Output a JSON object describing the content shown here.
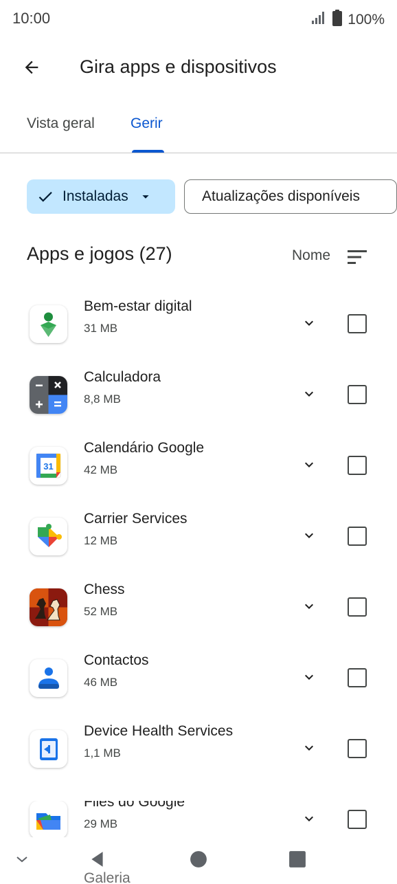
{
  "status": {
    "time": "10:00",
    "battery": "100%"
  },
  "header": {
    "title": "Gira apps e dispositivos"
  },
  "tabs": [
    {
      "label": "Vista geral",
      "active": false
    },
    {
      "label": "Gerir",
      "active": true
    }
  ],
  "filters": {
    "installed": "Instaladas",
    "updates": "Atualizações disponíveis"
  },
  "list": {
    "title": "Apps e jogos (27)",
    "sort_label": "Nome",
    "apps": [
      {
        "name": "Bem-estar digital",
        "size": "31 MB",
        "icon": "digital-wellbeing-icon"
      },
      {
        "name": "Calculadora",
        "size": "8,8 MB",
        "icon": "calculator-icon"
      },
      {
        "name": "Calendário Google",
        "size": "42 MB",
        "icon": "google-calendar-icon"
      },
      {
        "name": "Carrier Services",
        "size": "12 MB",
        "icon": "carrier-services-icon"
      },
      {
        "name": "Chess",
        "size": "52 MB",
        "icon": "chess-icon"
      },
      {
        "name": "Contactos",
        "size": "46 MB",
        "icon": "contacts-icon"
      },
      {
        "name": "Device Health Services",
        "size": "1,1 MB",
        "icon": "device-health-icon"
      },
      {
        "name": "Files do Google",
        "size": "29 MB",
        "icon": "files-icon"
      },
      {
        "name": "Galeria",
        "size": "",
        "icon": "gallery-icon"
      }
    ]
  },
  "colors": {
    "accent": "#0b57d0",
    "chip_selected_bg": "#c2e7ff",
    "text": "#1f1f1f",
    "secondary_text": "#444746"
  }
}
